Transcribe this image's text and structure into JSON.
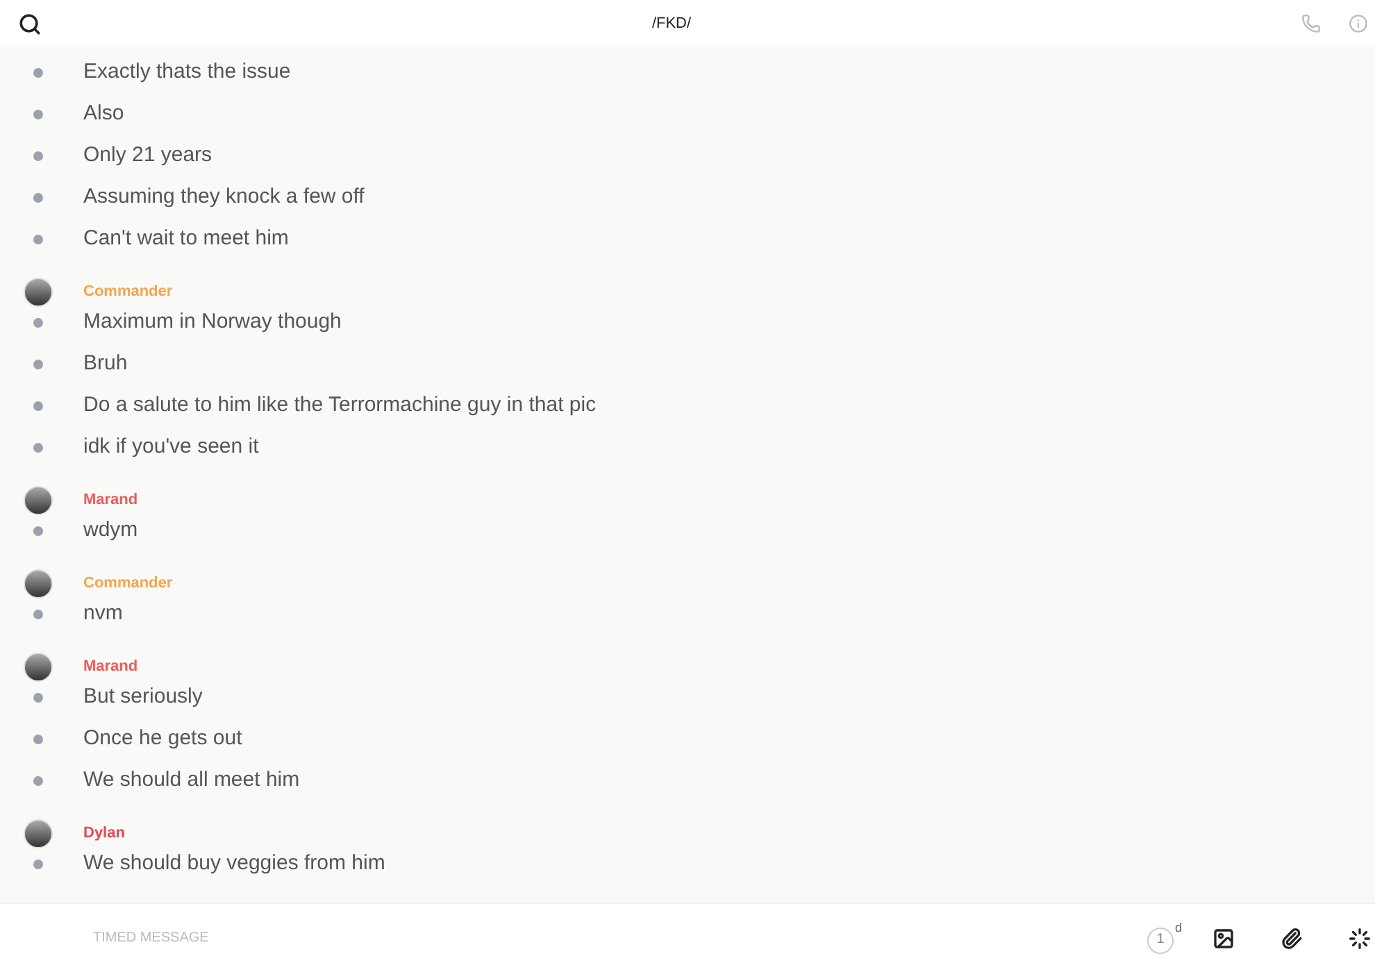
{
  "header": {
    "title": "/FKD/"
  },
  "groups": [
    {
      "messages": [
        "Exactly thats the issue",
        "Also",
        "Only 21 years",
        "Assuming they knock a few off",
        "Can't wait to meet him"
      ]
    },
    {
      "sender": "Commander",
      "color": "#f5a54a",
      "messages": [
        "Maximum in Norway though",
        "Bruh",
        "Do a salute to him like the Terrormachine guy in that pic",
        "idk if you've seen it"
      ]
    },
    {
      "sender": "Marand",
      "color": "#ef5a5a",
      "messages": [
        "wdym"
      ]
    },
    {
      "sender": "Commander",
      "color": "#f5a54a",
      "messages": [
        "nvm"
      ]
    },
    {
      "sender": "Marand",
      "color": "#ef5a5a",
      "messages": [
        "But seriously",
        "Once he gets out",
        "We should all meet him"
      ]
    },
    {
      "sender": "Dylan",
      "color": "#e8474f",
      "messages": [
        "We should buy veggies from him"
      ]
    }
  ],
  "composer": {
    "placeholder": "TIMED MESSAGE",
    "timer": "1",
    "timer_unit": "d"
  }
}
